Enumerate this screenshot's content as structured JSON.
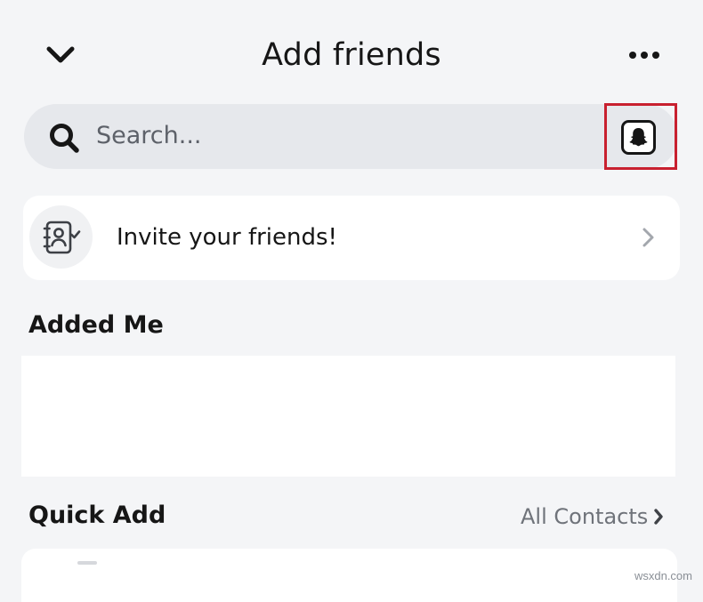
{
  "header": {
    "title": "Add friends",
    "back_icon": "chevron-down-icon",
    "more_icon": "more-horizontal-icon"
  },
  "search": {
    "placeholder": "Search...",
    "icon": "search-icon",
    "snapcode_icon": "ghost-icon"
  },
  "invite": {
    "label": "Invite your friends!",
    "icon": "contacts-book-check-icon",
    "chevron": "chevron-right-icon"
  },
  "sections": {
    "added_me": "Added Me",
    "quick_add": "Quick Add",
    "all_contacts": "All Contacts"
  },
  "footer": {
    "watermark": "wsxdn.com"
  },
  "colors": {
    "background": "#f4f5f7",
    "card": "#ffffff",
    "search_bg": "#e6e8ec",
    "highlight": "#c8202f",
    "text": "#161616",
    "muted": "#6f737a"
  }
}
